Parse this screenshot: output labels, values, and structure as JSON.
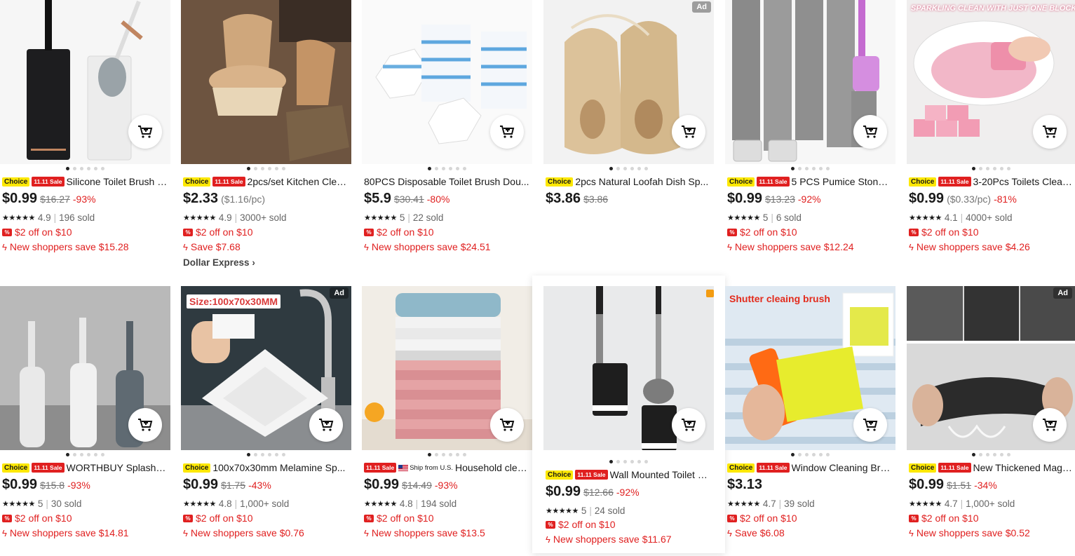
{
  "products": [
    {
      "title": "Silicone Toilet Brush S...",
      "badges": {
        "choice": "Choice",
        "sale": "11.11 Sale"
      },
      "price": "$0.99",
      "orig": "$16.27",
      "disc": "-93%",
      "rating": "4.9",
      "sold": "196 sold",
      "coupon": "$2 off on $10",
      "promo": "New shoppers save $15.28",
      "icon": "toilet-brush-set-image"
    },
    {
      "title": "2pcs/set Kitchen Clea...",
      "badges": {
        "choice": "Choice",
        "sale": "11.11 Sale"
      },
      "price": "$2.33",
      "unit": "($1.16/pc)",
      "rating": "4.9",
      "sold": "3000+ sold",
      "coupon": "$2 off on $10",
      "promo": "Save $7.68",
      "store": "Dollar Express",
      "icon": "wooden-brush-image"
    },
    {
      "title": "80PCS Disposable Toilet Brush Dou...",
      "price": "$5.9",
      "orig": "$30.41",
      "disc": "-80%",
      "rating": "5",
      "sold": "22 sold",
      "coupon": "$2 off on $10",
      "promo": "New shoppers save $24.51",
      "icon": "hexagon-pads-image"
    },
    {
      "title": "2pcs Natural Loofah Dish Sp...",
      "badges": {
        "choice": "Choice"
      },
      "price": "$3.86",
      "orig": "$3.86",
      "ad": "Ad",
      "icon": "loofah-image"
    },
    {
      "title": "5 PCS Pumice Stone ...",
      "badges": {
        "choice": "Choice",
        "sale": "11.11 Sale"
      },
      "price": "$0.99",
      "orig": "$13.23",
      "disc": "-92%",
      "rating": "5",
      "sold": "6 sold",
      "coupon": "$2 off on $10",
      "promo": "New shoppers save $12.24",
      "icon": "pumice-stone-image"
    },
    {
      "title": "3-20Pcs Toilets Cleani...",
      "badges": {
        "choice": "Choice",
        "sale": "11.11 Sale"
      },
      "price": "$0.99",
      "unit": "($0.33/pc)",
      "disc": "-81%",
      "rating": "4.1",
      "sold": "4000+ sold",
      "coupon": "$2 off on $10",
      "promo": "New shoppers save $4.26",
      "banner": "SPARKLING CLEAN WITH JUST ONE BLOCK !",
      "icon": "toilet-block-image"
    },
    {
      "title": "WORTHBUY Splash P...",
      "badges": {
        "choice": "Choice",
        "sale": "11.11 Sale"
      },
      "price": "$0.99",
      "orig": "$15.8",
      "disc": "-93%",
      "rating": "5",
      "sold": "30 sold",
      "coupon": "$2 off on $10",
      "promo": "New shoppers save $14.81",
      "icon": "toilet-brush-holders-image"
    },
    {
      "title": "100x70x30mm Melamine Sp...",
      "badges": {
        "choice": "Choice"
      },
      "price": "$0.99",
      "orig": "$1.75",
      "disc": "-43%",
      "rating": "4.8",
      "sold": "1,000+ sold",
      "coupon": "$2 off on $10",
      "promo": "New shoppers save $0.76",
      "ad": "Ad",
      "banner": "Size:100x70x30MM",
      "icon": "melamine-sponge-image"
    },
    {
      "title": "Household clea...",
      "badges": {
        "sale": "11.11 Sale",
        "ship": "Ship from U.S."
      },
      "price": "$0.99",
      "orig": "$14.49",
      "disc": "-93%",
      "rating": "4.8",
      "sold": "194 sold",
      "coupon": "$2 off on $10",
      "promo": "New shoppers save $13.5",
      "icon": "cloth-stack-image"
    },
    {
      "title": "Wall Mounted Toilet B...",
      "badges": {
        "choice": "Choice",
        "sale": "11.11 Sale"
      },
      "price": "$0.99",
      "orig": "$12.66",
      "disc": "-92%",
      "rating": "5",
      "sold": "24 sold",
      "coupon": "$2 off on $10",
      "promo": "New shoppers save $11.67",
      "icon": "wall-mounted-brush-image"
    },
    {
      "title": "Window Cleaning Bru...",
      "badges": {
        "choice": "Choice",
        "sale": "11.11 Sale"
      },
      "price": "$3.13",
      "rating": "4.7",
      "sold": "39 sold",
      "coupon": "$2 off on $10",
      "promo": "Save $6.08",
      "banner": "Shutter cleaing brush",
      "icon": "shutter-brush-image"
    },
    {
      "title": "New Thickened Magic...",
      "badges": {
        "choice": "Choice",
        "sale": "11.11 Sale"
      },
      "price": "$0.99",
      "orig": "$1.51",
      "disc": "-34%",
      "rating": "4.7",
      "sold": "1,000+ sold",
      "coupon": "$2 off on $10",
      "promo": "New shoppers save $0.52",
      "ad": "Ad",
      "icon": "magic-cloth-image"
    }
  ],
  "colors": {
    "accent": "#e02020",
    "choice": "#fde802",
    "text": "#191919"
  }
}
